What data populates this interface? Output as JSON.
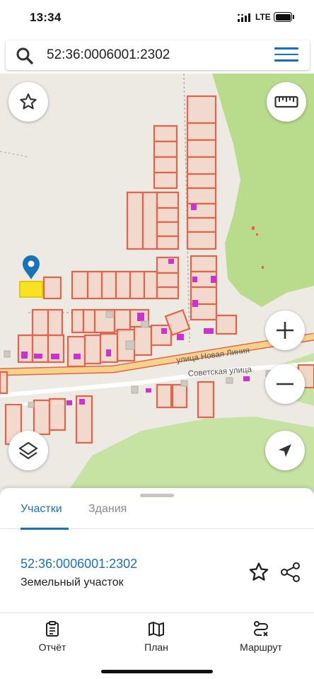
{
  "status_bar": {
    "time": "13:34",
    "network": "LTE"
  },
  "search": {
    "value": "52:36:0006001:2302"
  },
  "map": {
    "street_labels": [
      "улица Новая Линия",
      "Советская улица"
    ],
    "colors": {
      "background": "#eceae3",
      "forest": "#b9dc8c",
      "parcel_fill": "#f2d6c9",
      "parcel_border": "#e6634a",
      "building": "#cc33cc",
      "selected_parcel": "#f7e224",
      "marker": "#1a73b8",
      "road": "#f6d28a"
    },
    "icons": {
      "favorite": "star-icon",
      "ruler": "ruler-icon",
      "zoom_in": "plus-icon",
      "zoom_out": "minus-icon",
      "layers": "layers-icon",
      "locate": "navigation-arrow-icon"
    }
  },
  "sheet": {
    "tabs": [
      {
        "label": "Участки",
        "active": true
      },
      {
        "label": "Здания",
        "active": false
      }
    ],
    "parcel": {
      "number": "52:36:0006001:2302",
      "type": "Земельный участок"
    },
    "accent": "#1a73b8"
  },
  "nav": {
    "items": [
      {
        "label": "Отчёт",
        "icon": "clipboard-icon"
      },
      {
        "label": "План",
        "icon": "map-icon"
      },
      {
        "label": "Маршрут",
        "icon": "route-icon"
      }
    ]
  }
}
